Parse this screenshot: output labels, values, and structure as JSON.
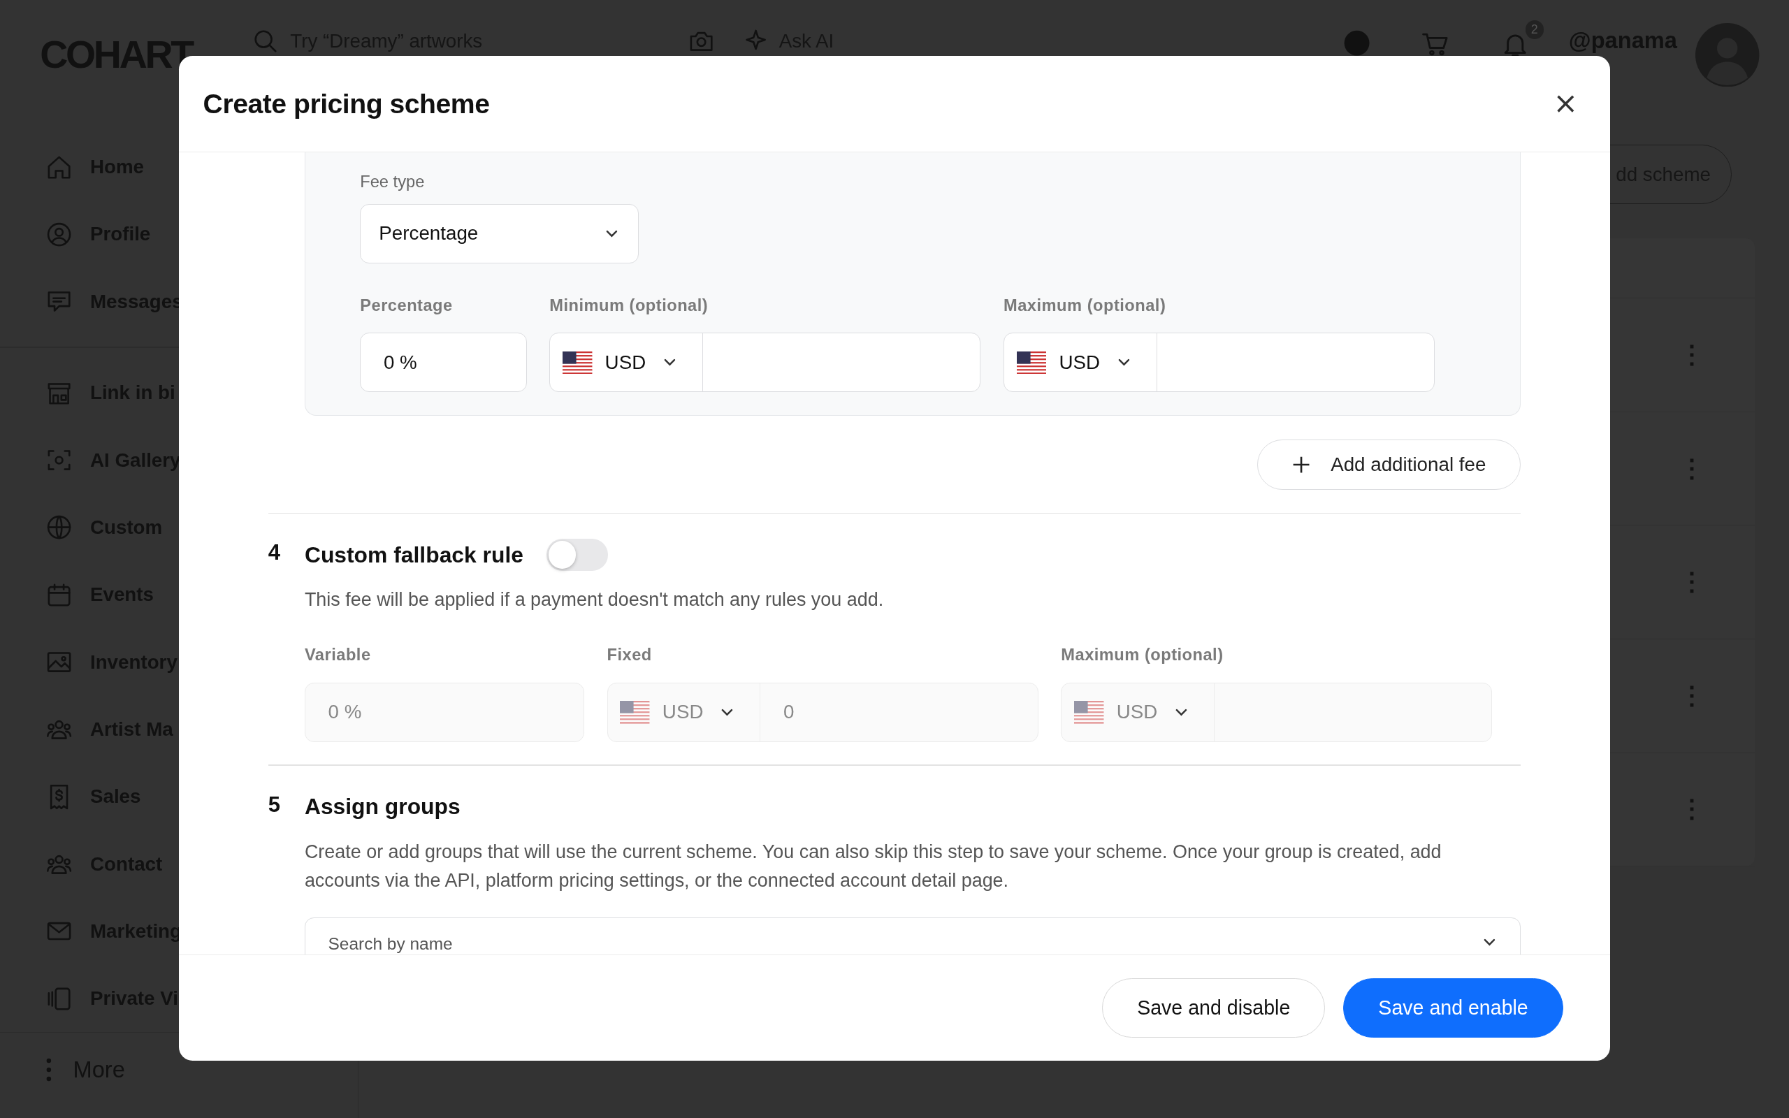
{
  "app_bar": {
    "logo": "COHART",
    "search": {
      "placeholder": "Try “Dreamy” artworks"
    },
    "ask_ai": "Ask AI",
    "notification_count": "2",
    "username": "@panama"
  },
  "sidebar": {
    "items": [
      {
        "label": "Home"
      },
      {
        "label": "Profile"
      },
      {
        "label": "Messages"
      },
      {
        "label": "Link in bi"
      },
      {
        "label": "AI Gallery"
      },
      {
        "label": "Custom"
      },
      {
        "label": "Events"
      },
      {
        "label": "Inventory"
      },
      {
        "label": "Artist Ma"
      },
      {
        "label": "Sales"
      },
      {
        "label": "Contact"
      },
      {
        "label": "Marketing"
      },
      {
        "label": "Private Vi"
      }
    ],
    "more": "More"
  },
  "schemes": {
    "add_button": "dd scheme",
    "rows": [
      {
        "menu": "⋮"
      },
      {
        "menu": "⋮"
      },
      {
        "menu": "⋮"
      },
      {
        "menu": "⋮"
      },
      {
        "menu": "⋮"
      }
    ]
  },
  "dialog": {
    "title": "Create pricing scheme",
    "close": "×",
    "fee": {
      "fee_type": {
        "label": "Fee type",
        "value": "Percentage"
      },
      "fields": [
        {
          "kind": "percent",
          "label": "Percentage",
          "value": "0 %",
          "disabled": false
        },
        {
          "kind": "money",
          "label": "Minimum (optional)",
          "currency": "USD",
          "disabled": false
        },
        {
          "kind": "money",
          "label": "Maximum (optional)",
          "currency": "USD",
          "disabled": false
        }
      ]
    },
    "add_fee_button": "Add additional fee",
    "sections": [
      {
        "number": "4",
        "title": "Custom fallback rule",
        "toggle": {
          "on": false
        },
        "description": "This fee will be applied if a payment doesn't match any rules you add.",
        "fields": [
          {
            "kind": "percent",
            "label": "Variable",
            "value": "0 %",
            "disabled": true
          },
          {
            "kind": "money",
            "label": "Fixed",
            "currency": "USD",
            "value": "0",
            "disabled": true
          },
          {
            "kind": "money",
            "label": "Maximum (optional)",
            "currency": "USD",
            "disabled": true
          }
        ]
      },
      {
        "number": "5",
        "title": "Assign groups",
        "description": "Create or add groups that will use the current scheme. You can also skip this step to save your scheme. Once your group is created, add accounts via the API, platform pricing settings, or the connected account detail page.",
        "search": {
          "placeholder": "Search by name"
        }
      }
    ],
    "buttons": [
      {
        "label": "Save and disable",
        "kind": "secondary"
      },
      {
        "label": "Save and enable",
        "kind": "primary"
      }
    ]
  }
}
